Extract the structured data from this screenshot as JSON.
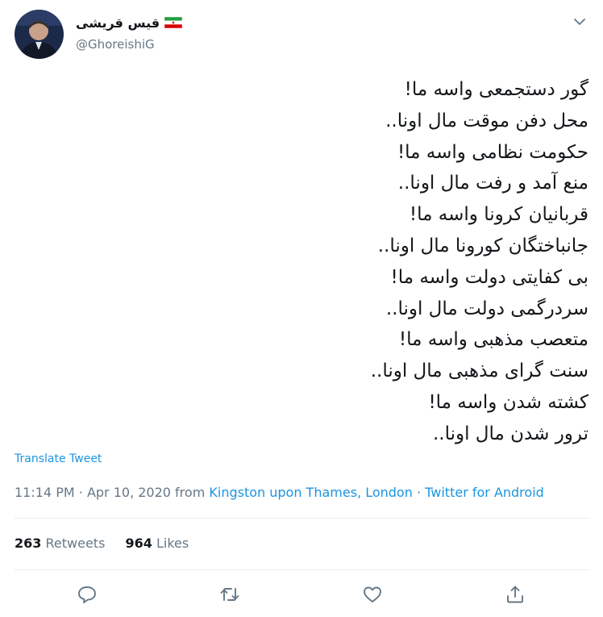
{
  "user": {
    "display_name": "قیس قریشی",
    "handle": "@GhoreishiG",
    "flag_icon": "iran-flag-icon"
  },
  "tweet": {
    "lines": [
      "گور دستجمعی واسه ما!",
      "محل دفن موقت مال اونا..",
      "حکومت نظامی واسه ما!",
      "منع آمد و رفت مال اونا..",
      "قربانیان کرونا واسه ما!",
      "جانباختگان کورونا مال اونا..",
      "بی کفایتی دولت واسه ما!",
      "سردرگمی دولت مال اونا..",
      "متعصب مذهبی واسه ما!",
      "سنت گرای مذهبی مال اونا..",
      "کشته شدن واسه ما!",
      "ترور شدن مال اونا.."
    ],
    "translate_label": "Translate Tweet",
    "time": "11:14 PM",
    "date": "Apr 10, 2020",
    "from_label": "from",
    "location": "Kingston upon Thames, London",
    "source": "Twitter for Android",
    "separator": "·"
  },
  "stats": {
    "retweets_count": "263",
    "retweets_label": "Retweets",
    "likes_count": "964",
    "likes_label": "Likes"
  },
  "colors": {
    "link": "#1b95e0",
    "secondary_text": "#657786",
    "divider": "#e6ecf0"
  }
}
